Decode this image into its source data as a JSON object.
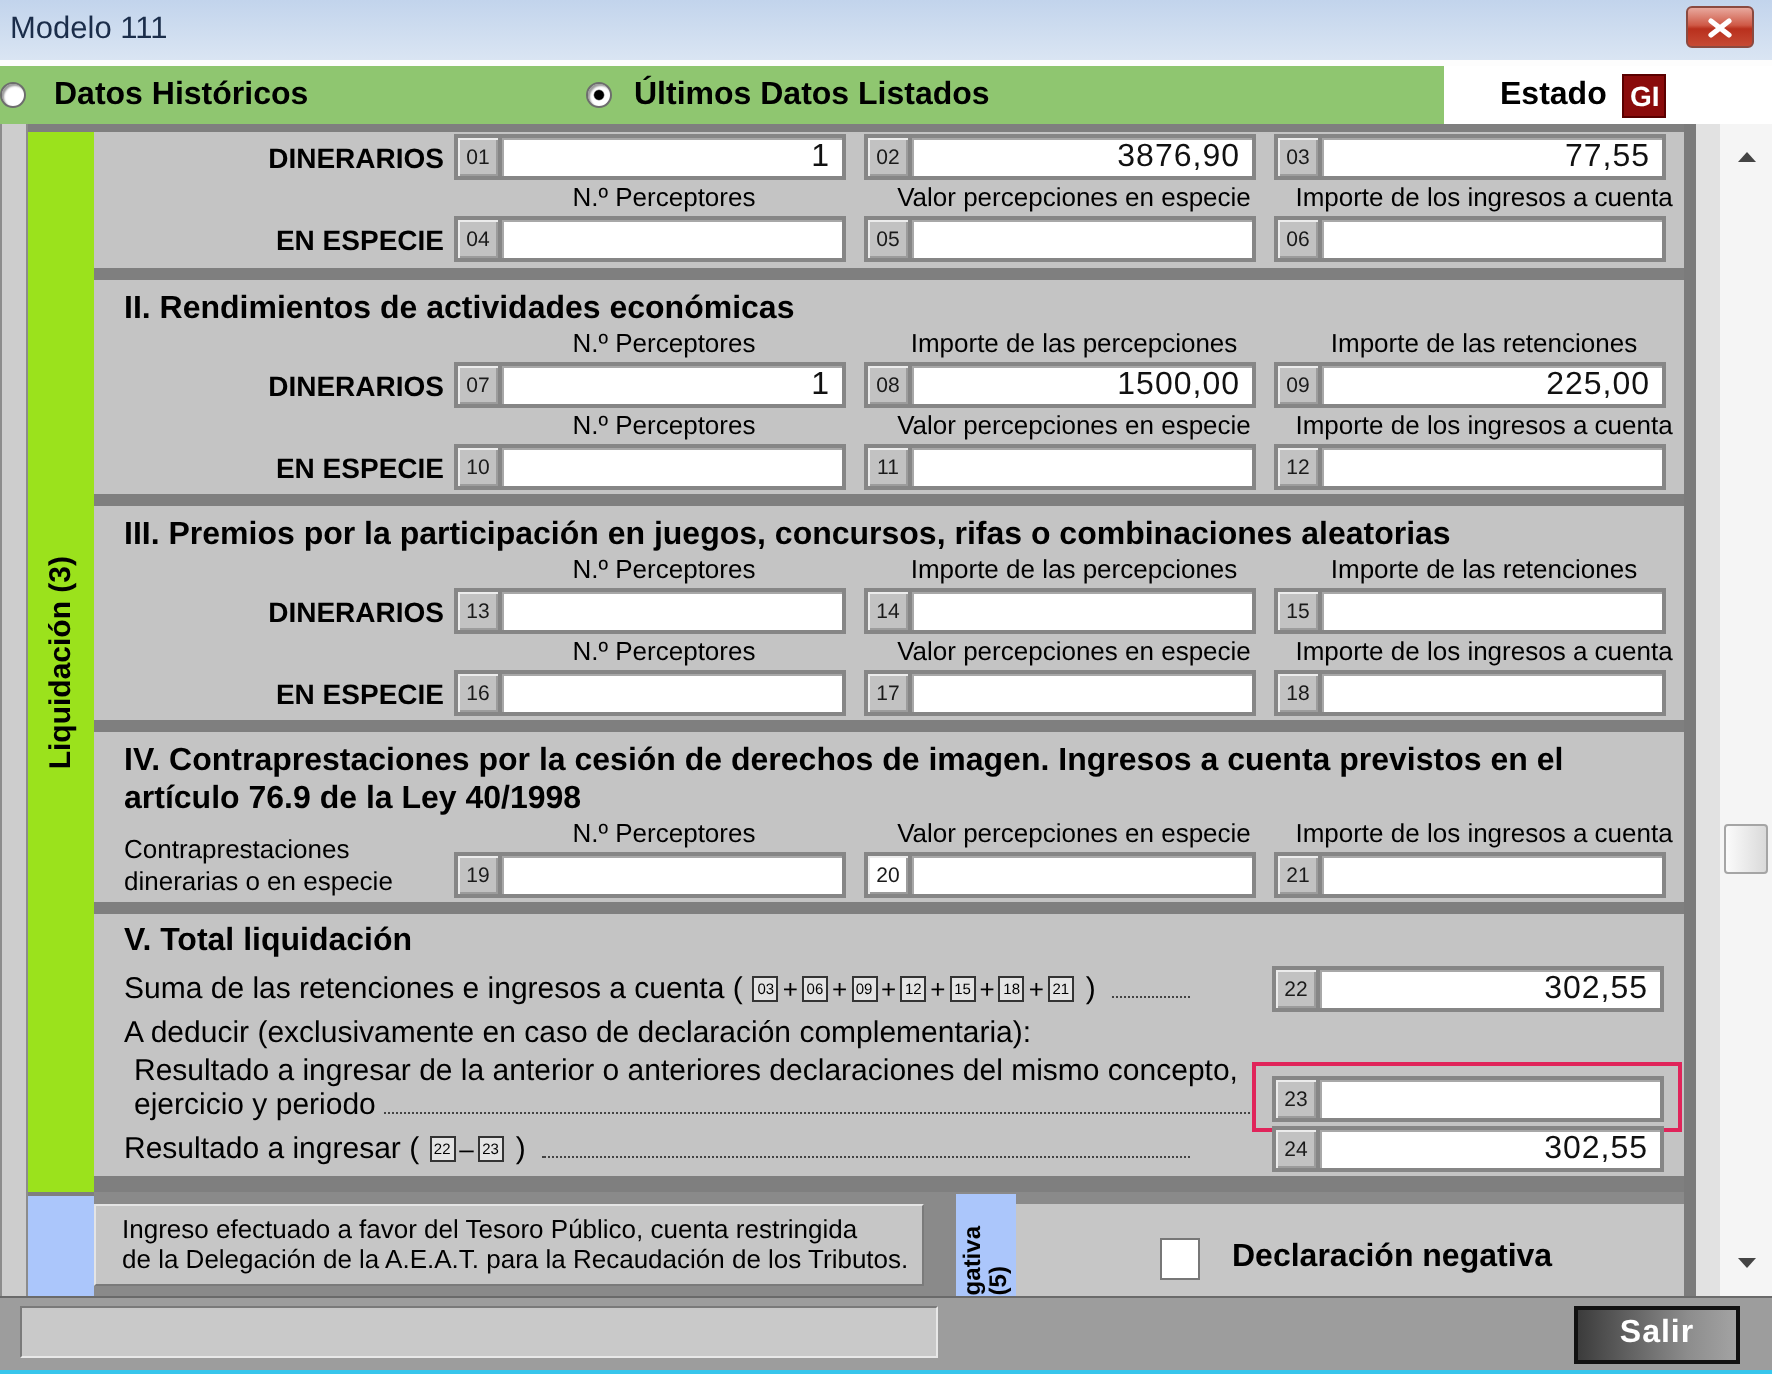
{
  "window": {
    "title": "Modelo 111"
  },
  "source_options": [
    {
      "label": "Datos Históricos",
      "selected": false
    },
    {
      "label": "Últimos Datos Listados",
      "selected": true
    }
  ],
  "status": {
    "label": "Estado",
    "badge": "GI"
  },
  "side_label": "Liquidación (3)",
  "sections": [
    {
      "rows": [
        {
          "kind": "fields",
          "label": "DINERARIOS",
          "boxes": [
            {
              "code": "01",
              "value": "1"
            },
            {
              "code": "02",
              "value": "3876,90"
            },
            {
              "code": "03",
              "value": "77,55"
            }
          ]
        },
        {
          "kind": "captions",
          "texts": [
            "N.º Perceptores",
            "Valor percepciones en especie",
            "Importe de los ingresos a cuenta"
          ]
        },
        {
          "kind": "fields",
          "label": "EN ESPECIE",
          "boxes": [
            {
              "code": "04"
            },
            {
              "code": "05"
            },
            {
              "code": "06"
            }
          ]
        }
      ]
    },
    {
      "title": "II. Rendimientos de actividades económicas",
      "rows": [
        {
          "kind": "captions",
          "texts": [
            "N.º Perceptores",
            "Importe de las percepciones",
            "Importe de las retenciones"
          ]
        },
        {
          "kind": "fields",
          "label": "DINERARIOS",
          "boxes": [
            {
              "code": "07",
              "value": "1"
            },
            {
              "code": "08",
              "value": "1500,00"
            },
            {
              "code": "09",
              "value": "225,00"
            }
          ]
        },
        {
          "kind": "captions",
          "texts": [
            "N.º Perceptores",
            "Valor percepciones en especie",
            "Importe de los ingresos a cuenta"
          ]
        },
        {
          "kind": "fields",
          "label": "EN ESPECIE",
          "boxes": [
            {
              "code": "10"
            },
            {
              "code": "11"
            },
            {
              "code": "12"
            }
          ]
        }
      ]
    },
    {
      "title": "III. Premios por la participación en juegos, concursos, rifas o combinaciones aleatorias",
      "rows": [
        {
          "kind": "captions",
          "texts": [
            "N.º Perceptores",
            "Importe de las percepciones",
            "Importe de las retenciones"
          ]
        },
        {
          "kind": "fields",
          "label": "DINERARIOS",
          "boxes": [
            {
              "code": "13"
            },
            {
              "code": "14"
            },
            {
              "code": "15"
            }
          ]
        },
        {
          "kind": "captions",
          "texts": [
            "N.º Perceptores",
            "Valor percepciones en especie",
            "Importe de los ingresos a cuenta"
          ]
        },
        {
          "kind": "fields",
          "label": "EN ESPECIE",
          "boxes": [
            {
              "code": "16"
            },
            {
              "code": "17"
            },
            {
              "code": "18"
            }
          ]
        }
      ]
    },
    {
      "title": "IV. Contraprestaciones por la cesión de derechos de imagen. Ingresos a cuenta previstos en el artículo 76.9 de la Ley 40/1998",
      "rows": [
        {
          "kind": "captions",
          "texts": [
            "N.º Perceptores",
            "Valor percepciones en especie",
            "Importe de los ingresos a cuenta"
          ]
        },
        {
          "kind": "note_fields",
          "label": "Contraprestaciones dinerarias o en especie",
          "boxes": [
            {
              "code": "19",
              "focused": false
            },
            {
              "code": "20",
              "focused": true
            },
            {
              "code": "21",
              "focused": false
            }
          ]
        }
      ]
    }
  ],
  "total": {
    "title": "V. Total liquidación",
    "lines": [
      {
        "kind": "formula",
        "text": "Suma de las retenciones e ingresos a cuenta (",
        "terms": [
          {
            "kind": "ref",
            "text": "03"
          },
          {
            "kind": "op",
            "text": "+"
          },
          {
            "kind": "ref",
            "text": "06"
          },
          {
            "kind": "op",
            "text": "+"
          },
          {
            "kind": "ref",
            "text": "09"
          },
          {
            "kind": "op",
            "text": "+"
          },
          {
            "kind": "ref",
            "text": "12"
          },
          {
            "kind": "op",
            "text": "+"
          },
          {
            "kind": "ref",
            "text": "15"
          },
          {
            "kind": "op",
            "text": "+"
          },
          {
            "kind": "ref",
            "text": "18"
          },
          {
            "kind": "op",
            "text": "+"
          },
          {
            "kind": "ref",
            "text": "21"
          }
        ],
        "close": ")",
        "box": {
          "code": "22",
          "value": "302,55",
          "highlighted": false
        }
      },
      {
        "kind": "note",
        "text": "A deducir (exclusivamente en caso de declaración complementaria):"
      },
      {
        "kind": "paragraph",
        "lines": [
          "Resultado a ingresar de la anterior o anteriores declaraciones del mismo concepto,",
          "ejercicio y periodo"
        ],
        "box": {
          "code": "23",
          "highlighted": true
        }
      },
      {
        "kind": "formula",
        "text": "Resultado a ingresar (",
        "terms": [
          {
            "kind": "ref",
            "text": "22"
          },
          {
            "kind": "op",
            "text": "–"
          },
          {
            "kind": "ref",
            "text": "23"
          }
        ],
        "close": ")",
        "box": {
          "code": "24",
          "value": "302,55",
          "highlighted": false
        }
      }
    ]
  },
  "payment_note": {
    "lines": [
      "Ingreso efectuado a favor del Tesoro Público, cuenta restringida",
      "de la Delegación de la A.E.A.T. para la Recaudación de los Tributos."
    ]
  },
  "negative": {
    "strip_lines": [
      "gativa",
      "(5)"
    ],
    "checked": false,
    "label": "Declaración negativa"
  },
  "footer": {
    "exit_button": "Salir"
  }
}
